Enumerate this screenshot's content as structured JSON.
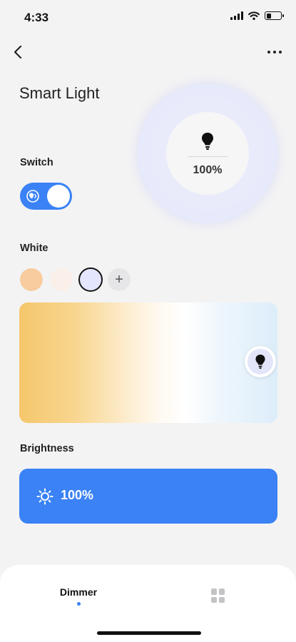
{
  "status_bar": {
    "time": "4:33",
    "icons": [
      "signal-icon",
      "wifi-icon",
      "battery-icon"
    ]
  },
  "header": {
    "back_icon": "chevron-left-icon",
    "more_icon": "more-horizontal-icon"
  },
  "device": {
    "title": "Smart Light",
    "brightness_display": "100%",
    "bulb_icon": "bulb-icon"
  },
  "switch": {
    "label": "Switch",
    "state": "on",
    "icon": "light-toggle-icon"
  },
  "white": {
    "label": "White",
    "swatches": [
      {
        "name": "warm",
        "color": "#f8cc9f"
      },
      {
        "name": "neutral",
        "color": "#fbefe9"
      },
      {
        "name": "cool",
        "color": "#e3e6fc",
        "selected": true
      }
    ],
    "add_label": "+",
    "temperature_position": 0.93
  },
  "brightness": {
    "label": "Brightness",
    "value": "100%",
    "icon": "sun-icon"
  },
  "bottom_nav": {
    "tabs": [
      {
        "label": "Dimmer",
        "active": true
      },
      {
        "label": "",
        "icon": "grid-icon",
        "active": false
      }
    ]
  },
  "colors": {
    "accent": "#3a82f5",
    "background": "#f3f3f4",
    "ring": "#e9ebfb"
  }
}
